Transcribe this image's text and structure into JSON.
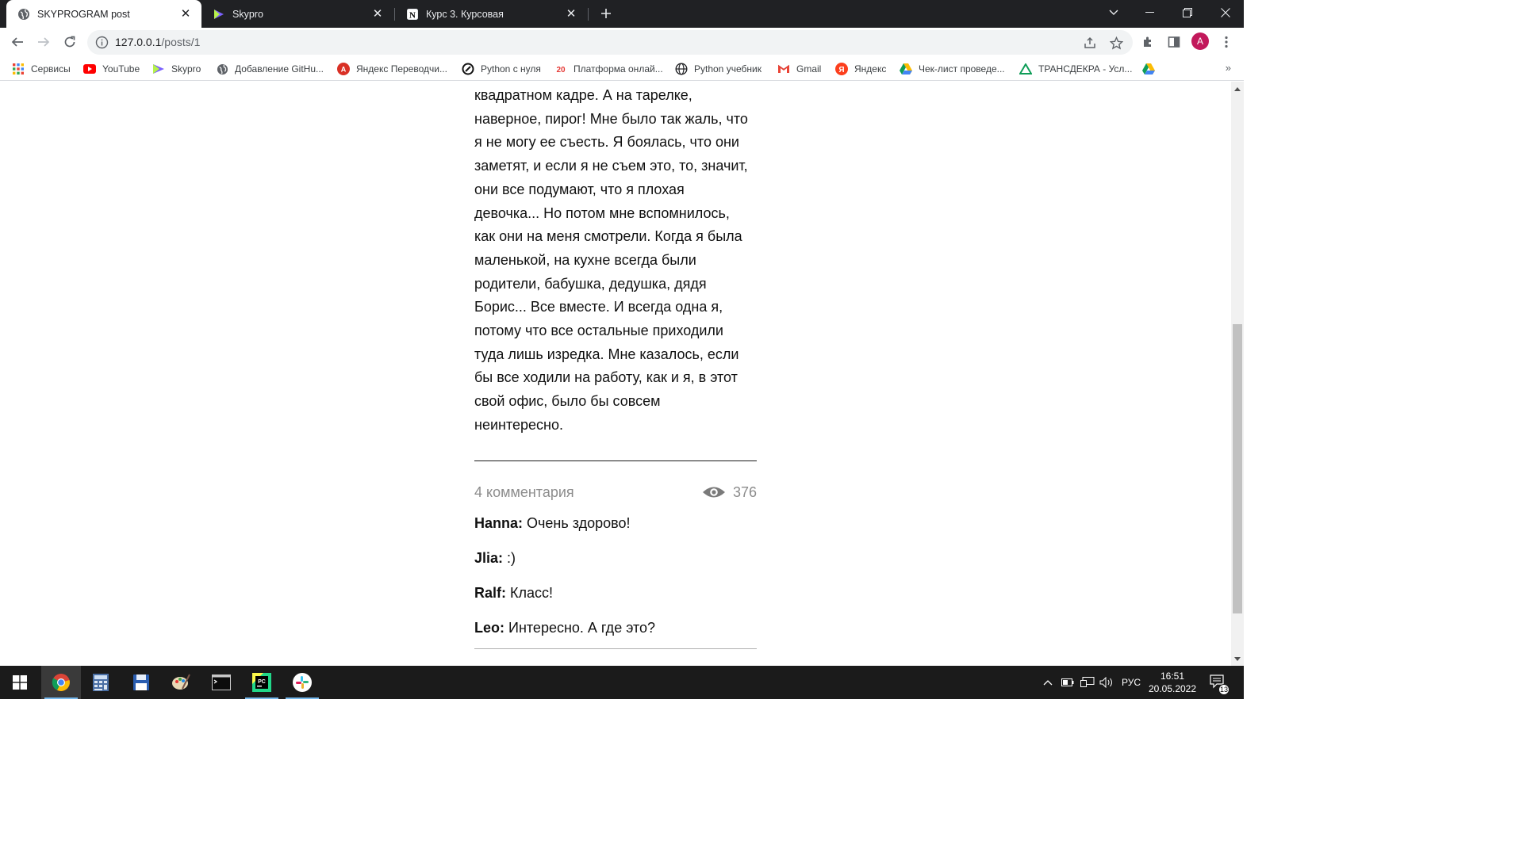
{
  "browser": {
    "tabs": [
      {
        "title": "SKYPROGRAM post",
        "active": true,
        "icon": "globe-icon"
      },
      {
        "title": "Skypro",
        "active": false,
        "icon": "skypro-icon"
      },
      {
        "title": "Курс 3. Курсовая",
        "active": false,
        "icon": "notion-icon"
      }
    ],
    "address": {
      "host": "127.0.0.1",
      "path": "/posts/1"
    },
    "profile_initial": "A",
    "bookmarks": [
      {
        "label": "Сервисы",
        "icon": "apps-grid-icon"
      },
      {
        "label": "YouTube",
        "icon": "youtube-icon"
      },
      {
        "label": "Skypro",
        "icon": "skypro-icon"
      },
      {
        "label": "Добавление GitHu...",
        "icon": "globe-icon"
      },
      {
        "label": "Яндекс Переводчи...",
        "icon": "translate-icon"
      },
      {
        "label": "Python с нуля",
        "icon": "python-course-icon"
      },
      {
        "label": "Платформа онлай...",
        "icon": "platform-icon"
      },
      {
        "label": "Python учебник",
        "icon": "globe-icon"
      },
      {
        "label": "Gmail",
        "icon": "gmail-icon"
      },
      {
        "label": "Яндекс",
        "icon": "yandex-icon"
      },
      {
        "label": "Чек-лист проведе...",
        "icon": "google-drive-icon"
      },
      {
        "label": "ТРАНСДЕКРА - Усл...",
        "icon": "google-drive-icon"
      },
      {
        "label": "",
        "icon": "google-drive-icon"
      }
    ],
    "bookmarks_more": "»"
  },
  "post": {
    "text_lines": [
      "квадратном кадре. А на тарелке,",
      "наверное, пирог! Мне было так жаль, что",
      "я не могу ее съесть. Я боялась, что они",
      "заметят, и если я не съем это, то, значит,",
      "они все подумают, что я плохая",
      "девочка... Но потом мне вспомнилось,",
      "как они на меня смотрели. Когда я была",
      "маленькой, на кухне всегда были",
      "родители, бабушка, дедушка, дядя",
      "Борис... Все вместе. И всегда одна я,",
      "потому что все остальные приходили",
      "туда лишь изредка. Мне казалось, если",
      "бы все ходили на работу, как и я, в этот",
      "свой офис, было бы совсем",
      "неинтересно."
    ],
    "comments_count_label": "4 комментария",
    "views": "376",
    "comments": [
      {
        "author": "Hanna:",
        "text": "Очень здорово!"
      },
      {
        "author": "Jlia:",
        "text": ":)"
      },
      {
        "author": "Ralf:",
        "text": "Класс!"
      },
      {
        "author": "Leo:",
        "text": "Интересно. А где это?"
      }
    ]
  },
  "taskbar": {
    "apps": [
      "windows-start-icon",
      "chrome-icon",
      "calculator-icon",
      "save-disk-icon",
      "paint-icon",
      "terminal-icon",
      "pycharm-icon",
      "slack-icon"
    ],
    "language": "РУС",
    "time": "16:51",
    "date": "20.05.2022",
    "notifications": "13"
  },
  "colors": {
    "tabstrip": "#202124",
    "accent_profile": "#c2185b",
    "muted_text": "#8c8c8c"
  }
}
